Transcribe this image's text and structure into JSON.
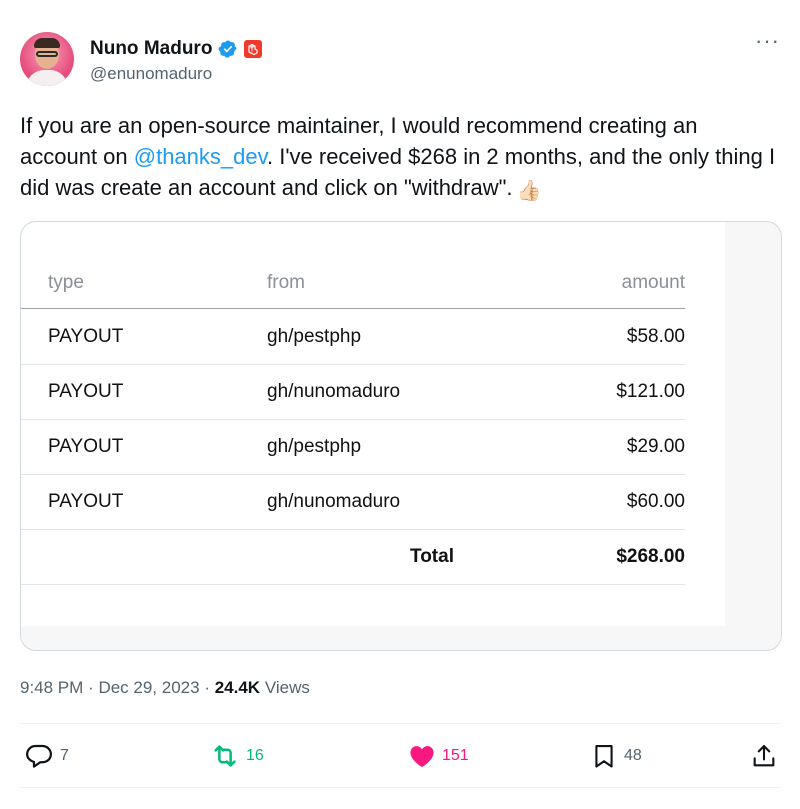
{
  "author": {
    "name": "Nuno Maduro",
    "handle": "@enunomaduro"
  },
  "tweet": {
    "text_before": "If you are an open-source maintainer, I would recommend creating an account on ",
    "mention": "@thanks_dev",
    "text_after": ". I've received $268 in 2 months, and the only thing I did was create an account and click on \"withdraw\".",
    "emoji": "👍🏻"
  },
  "media_table": {
    "headers": {
      "type": "type",
      "from": "from",
      "amount": "amount"
    },
    "rows": [
      {
        "type": "PAYOUT",
        "from": "gh/pestphp",
        "amount": "$58.00"
      },
      {
        "type": "PAYOUT",
        "from": "gh/nunomaduro",
        "amount": "$121.00"
      },
      {
        "type": "PAYOUT",
        "from": "gh/pestphp",
        "amount": "$29.00"
      },
      {
        "type": "PAYOUT",
        "from": "gh/nunomaduro",
        "amount": "$60.00"
      }
    ],
    "total_label": "Total",
    "total_amount": "$268.00"
  },
  "meta": {
    "time": "9:48 PM",
    "date": "Dec 29, 2023",
    "views_count": "24.4K",
    "views_label": "Views"
  },
  "actions": {
    "replies": "7",
    "reposts": "16",
    "likes": "151",
    "bookmarks": "48"
  },
  "icons": {
    "verified": "verified-badge-icon",
    "affiliate": "laravel-logo-icon",
    "more": "more-icon",
    "reply": "reply-icon",
    "repost": "repost-icon",
    "like": "heart-icon",
    "bookmark": "bookmark-icon",
    "share": "share-icon"
  },
  "colors": {
    "accent": "#1d9bf0",
    "repost": "#00ba7c",
    "like": "#f91880",
    "muted": "#536471"
  }
}
